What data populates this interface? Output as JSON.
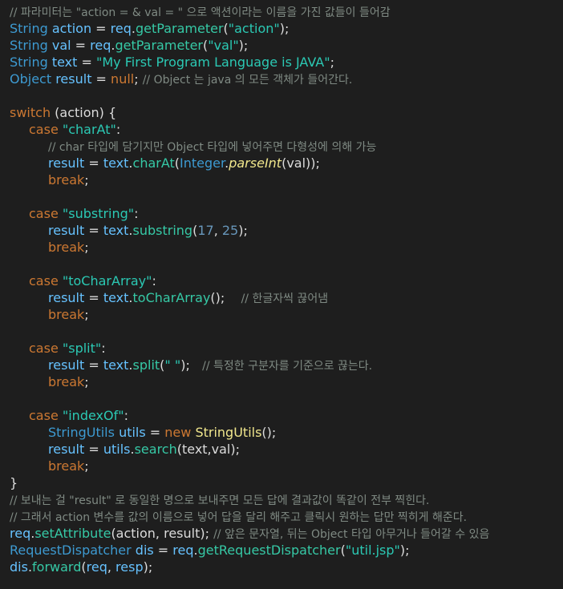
{
  "lines": [
    {
      "indent": 0,
      "tokens": [
        [
          "c",
          "// 파라미터는 \"action = & val = \" 으로 액션이라는 이름을 가진 값들이 들어감"
        ]
      ]
    },
    {
      "indent": 0,
      "tokens": [
        [
          "t",
          "String"
        ],
        [
          "p",
          " "
        ],
        [
          "lv",
          "action"
        ],
        [
          "p",
          " = "
        ],
        [
          "lv",
          "req"
        ],
        [
          "p",
          "."
        ],
        [
          "m",
          "getParameter"
        ],
        [
          "p",
          "("
        ],
        [
          "s",
          "\"action\""
        ],
        [
          "p",
          ");"
        ]
      ]
    },
    {
      "indent": 0,
      "tokens": [
        [
          "t",
          "String"
        ],
        [
          "p",
          " "
        ],
        [
          "lv",
          "val"
        ],
        [
          "p",
          " = "
        ],
        [
          "lv",
          "req"
        ],
        [
          "p",
          "."
        ],
        [
          "m",
          "getParameter"
        ],
        [
          "p",
          "("
        ],
        [
          "s",
          "\"val\""
        ],
        [
          "p",
          ");"
        ]
      ]
    },
    {
      "indent": 0,
      "tokens": [
        [
          "t",
          "String"
        ],
        [
          "p",
          " "
        ],
        [
          "lv",
          "text"
        ],
        [
          "p",
          " = "
        ],
        [
          "s",
          "\"My First Program Language is JAVA\""
        ],
        [
          "p",
          ";"
        ]
      ]
    },
    {
      "indent": 0,
      "tokens": [
        [
          "t",
          "Object"
        ],
        [
          "p",
          " "
        ],
        [
          "lv",
          "result"
        ],
        [
          "p",
          " = "
        ],
        [
          "k",
          "null"
        ],
        [
          "p",
          "; "
        ],
        [
          "c",
          "// Object 는 java 의 모든 객체가 들어간다."
        ]
      ]
    },
    {
      "indent": 0,
      "tokens": []
    },
    {
      "indent": 0,
      "tokens": [
        [
          "k",
          "switch"
        ],
        [
          "p",
          " ("
        ],
        [
          "p",
          "action"
        ],
        [
          "p",
          ") {"
        ]
      ]
    },
    {
      "indent": 1,
      "tokens": [
        [
          "k",
          "case"
        ],
        [
          "p",
          " "
        ],
        [
          "s",
          "\"charAt\""
        ],
        [
          "p",
          ":"
        ]
      ]
    },
    {
      "indent": 2,
      "tokens": [
        [
          "c",
          "// char 타입에 담기지만 Object 타입에 넣어주면 다형성에 의해 가능"
        ]
      ]
    },
    {
      "indent": 2,
      "tokens": [
        [
          "lv",
          "result"
        ],
        [
          "p",
          " = "
        ],
        [
          "lv",
          "text"
        ],
        [
          "p",
          "."
        ],
        [
          "m",
          "charAt"
        ],
        [
          "p",
          "("
        ],
        [
          "t",
          "Integer"
        ],
        [
          "p",
          "."
        ],
        [
          "i",
          "parseInt"
        ],
        [
          "p",
          "(val));"
        ]
      ]
    },
    {
      "indent": 2,
      "tokens": [
        [
          "k",
          "break"
        ],
        [
          "p",
          ";"
        ]
      ]
    },
    {
      "indent": 0,
      "tokens": []
    },
    {
      "indent": 1,
      "tokens": [
        [
          "k",
          "case"
        ],
        [
          "p",
          " "
        ],
        [
          "s",
          "\"substring\""
        ],
        [
          "p",
          ":"
        ]
      ]
    },
    {
      "indent": 2,
      "tokens": [
        [
          "lv",
          "result"
        ],
        [
          "p",
          " = "
        ],
        [
          "lv",
          "text"
        ],
        [
          "p",
          "."
        ],
        [
          "m",
          "substring"
        ],
        [
          "p",
          "("
        ],
        [
          "n",
          "17"
        ],
        [
          "p",
          ", "
        ],
        [
          "n",
          "25"
        ],
        [
          "p",
          ");"
        ]
      ]
    },
    {
      "indent": 2,
      "tokens": [
        [
          "k",
          "break"
        ],
        [
          "p",
          ";"
        ]
      ]
    },
    {
      "indent": 0,
      "tokens": []
    },
    {
      "indent": 1,
      "tokens": [
        [
          "k",
          "case"
        ],
        [
          "p",
          " "
        ],
        [
          "s",
          "\"toCharArray\""
        ],
        [
          "p",
          ":"
        ]
      ]
    },
    {
      "indent": 2,
      "tokens": [
        [
          "lv",
          "result"
        ],
        [
          "p",
          " = "
        ],
        [
          "lv",
          "text"
        ],
        [
          "p",
          "."
        ],
        [
          "m",
          "toCharArray"
        ],
        [
          "p",
          "();    "
        ],
        [
          "c",
          "// 한글자씩 끊어냄"
        ]
      ]
    },
    {
      "indent": 2,
      "tokens": [
        [
          "k",
          "break"
        ],
        [
          "p",
          ";"
        ]
      ]
    },
    {
      "indent": 0,
      "tokens": []
    },
    {
      "indent": 1,
      "tokens": [
        [
          "k",
          "case"
        ],
        [
          "p",
          " "
        ],
        [
          "s",
          "\"split\""
        ],
        [
          "p",
          ":"
        ]
      ]
    },
    {
      "indent": 2,
      "tokens": [
        [
          "lv",
          "result"
        ],
        [
          "p",
          " = "
        ],
        [
          "lv",
          "text"
        ],
        [
          "p",
          "."
        ],
        [
          "m",
          "split"
        ],
        [
          "p",
          "("
        ],
        [
          "s",
          "\" \""
        ],
        [
          "p",
          ");   "
        ],
        [
          "c",
          "// 특정한 구분자를 기준으로 끊는다."
        ]
      ]
    },
    {
      "indent": 2,
      "tokens": [
        [
          "k",
          "break"
        ],
        [
          "p",
          ";"
        ]
      ]
    },
    {
      "indent": 0,
      "tokens": []
    },
    {
      "indent": 1,
      "tokens": [
        [
          "k",
          "case"
        ],
        [
          "p",
          " "
        ],
        [
          "s",
          "\"indexOf\""
        ],
        [
          "p",
          ":"
        ]
      ]
    },
    {
      "indent": 2,
      "tokens": [
        [
          "t",
          "StringUtils"
        ],
        [
          "p",
          " "
        ],
        [
          "lv",
          "utils"
        ],
        [
          "p",
          " = "
        ],
        [
          "k",
          "new"
        ],
        [
          "p",
          " "
        ],
        [
          "y",
          "StringUtils"
        ],
        [
          "p",
          "();"
        ]
      ]
    },
    {
      "indent": 2,
      "tokens": [
        [
          "lv",
          "result"
        ],
        [
          "p",
          " = "
        ],
        [
          "lv",
          "utils"
        ],
        [
          "p",
          "."
        ],
        [
          "m",
          "search"
        ],
        [
          "p",
          "(text,val);"
        ]
      ]
    },
    {
      "indent": 2,
      "tokens": [
        [
          "k",
          "break"
        ],
        [
          "p",
          ";"
        ]
      ]
    },
    {
      "indent": 0,
      "tokens": [
        [
          "p",
          "}"
        ]
      ]
    },
    {
      "indent": 0,
      "tokens": [
        [
          "c",
          "// 보내는 걸 \"result\" 로 동일한 명으로 보내주면 모든 답에 결과값이 똑같이 전부 찍힌다."
        ]
      ]
    },
    {
      "indent": 0,
      "tokens": [
        [
          "c",
          "// 그래서 action 변수를 값의 이름으로 넣어 답을 달리 해주고 클릭시 원하는 답만 찍히게 해준다."
        ]
      ]
    },
    {
      "indent": 0,
      "tokens": [
        [
          "lv",
          "req"
        ],
        [
          "p",
          "."
        ],
        [
          "m",
          "setAttribute"
        ],
        [
          "p",
          "(action, result); "
        ],
        [
          "c",
          "// 앞은 문자열, 뒤는 Object 타입 아무거나 들어갈 수 있음"
        ]
      ]
    },
    {
      "indent": 0,
      "tokens": [
        [
          "t",
          "RequestDispatcher"
        ],
        [
          "p",
          " "
        ],
        [
          "lv",
          "dis"
        ],
        [
          "p",
          " = "
        ],
        [
          "lv",
          "req"
        ],
        [
          "p",
          "."
        ],
        [
          "m",
          "getRequestDispatcher"
        ],
        [
          "p",
          "("
        ],
        [
          "s",
          "\"util.jsp\""
        ],
        [
          "p",
          ");"
        ]
      ]
    },
    {
      "indent": 0,
      "tokens": [
        [
          "lv",
          "dis"
        ],
        [
          "p",
          "."
        ],
        [
          "m",
          "forward"
        ],
        [
          "p",
          "("
        ],
        [
          "lv",
          "req"
        ],
        [
          "p",
          ", "
        ],
        [
          "lv",
          "resp"
        ],
        [
          "p",
          ");"
        ]
      ]
    }
  ]
}
